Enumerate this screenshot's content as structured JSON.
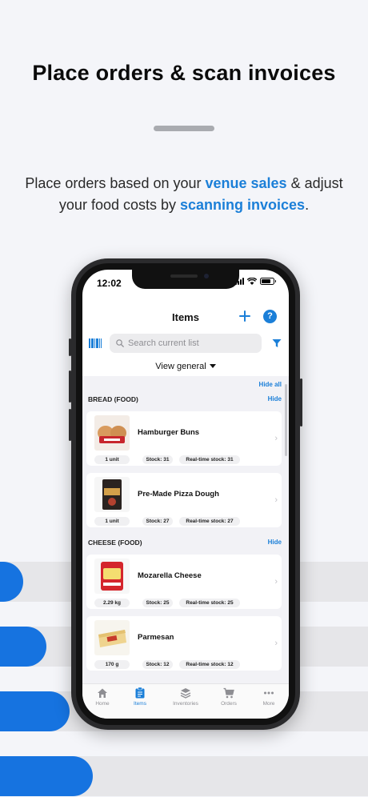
{
  "headline": "Place orders & scan invoices",
  "subtitle": {
    "part1": "Place orders based on your ",
    "highlight1": "venue sales",
    "part2": " & adjust your food costs by ",
    "highlight2": "scanning invoices",
    "part3": "."
  },
  "colors": {
    "accent": "#1b7fd8",
    "stripe_blue": "#1673e0",
    "background": "#f4f5f9"
  },
  "status_bar": {
    "time": "12:02"
  },
  "header": {
    "title": "Items",
    "add_icon": "plus-icon",
    "help_icon": "help-icon",
    "help_glyph": "?"
  },
  "search": {
    "placeholder": "Search current list",
    "barcode_icon": "barcode-icon",
    "filter_icon": "filter-icon"
  },
  "view_selector": {
    "value": "View general"
  },
  "list": {
    "hide_all_label": "Hide all",
    "sections": [
      {
        "title": "BREAD (FOOD)",
        "hide_label": "Hide",
        "items": [
          {
            "name": "Hamburger Buns",
            "unit": "1 unit",
            "stock": "Stock: 31",
            "realtime": "Real-time stock: 31"
          },
          {
            "name": "Pre-Made Pizza Dough",
            "unit": "1 unit",
            "stock": "Stock: 27",
            "realtime": "Real-time stock: 27"
          }
        ]
      },
      {
        "title": "CHEESE (FOOD)",
        "hide_label": "Hide",
        "items": [
          {
            "name": "Mozarella Cheese",
            "unit": "2.29 kg",
            "stock": "Stock: 25",
            "realtime": "Real-time stock: 25"
          },
          {
            "name": "Parmesan",
            "unit": "170 g",
            "stock": "Stock: 12",
            "realtime": "Real-time stock: 12"
          }
        ]
      }
    ]
  },
  "tabbar": {
    "tabs": [
      {
        "label": "Home",
        "icon": "home-icon"
      },
      {
        "label": "Items",
        "icon": "clipboard-icon",
        "active": true
      },
      {
        "label": "Inventories",
        "icon": "layers-icon"
      },
      {
        "label": "Orders",
        "icon": "cart-icon"
      },
      {
        "label": "More",
        "icon": "more-icon"
      }
    ]
  }
}
